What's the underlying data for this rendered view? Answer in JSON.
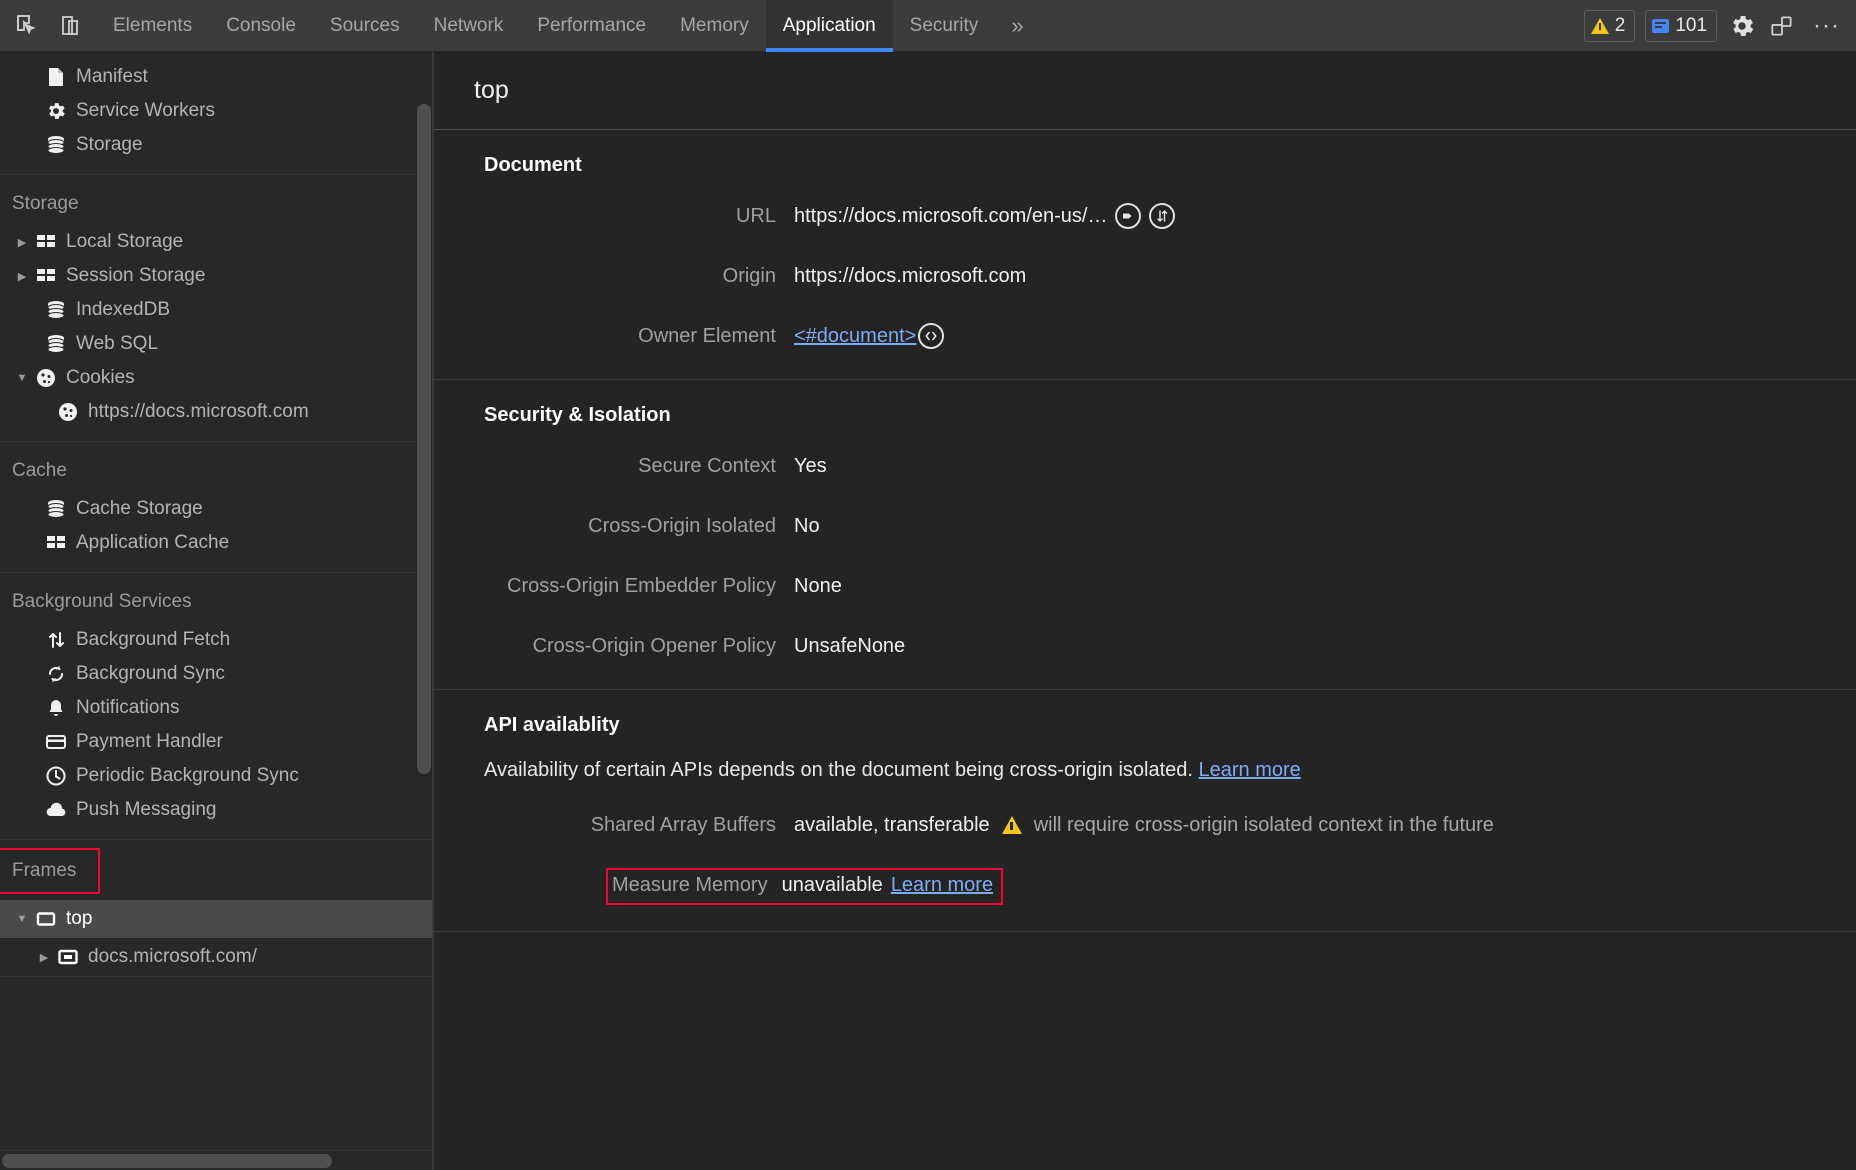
{
  "toolbar": {
    "icons": [
      {
        "name": "inspect-element-icon",
        "title": "Inspect element"
      },
      {
        "name": "device-toolbar-icon",
        "title": "Toggle device toolbar"
      }
    ],
    "tabs": [
      {
        "label": "Elements",
        "active": false
      },
      {
        "label": "Console",
        "active": false
      },
      {
        "label": "Sources",
        "active": false
      },
      {
        "label": "Network",
        "active": false
      },
      {
        "label": "Performance",
        "active": false
      },
      {
        "label": "Memory",
        "active": false
      },
      {
        "label": "Application",
        "active": true
      },
      {
        "label": "Security",
        "active": false
      }
    ],
    "more_tabs_glyph": "»",
    "warning_count": "2",
    "message_count": "101",
    "settings_label": "Settings",
    "dock_label": "Dock side",
    "more_options_glyph": "···"
  },
  "sidebar": {
    "groups": [
      {
        "title": null,
        "items": [
          {
            "label": "Manifest",
            "icon": "document-icon",
            "caret": null,
            "indent": 2,
            "selected": false
          },
          {
            "label": "Service Workers",
            "icon": "gear-icon",
            "caret": null,
            "indent": 2,
            "selected": false
          },
          {
            "label": "Storage",
            "icon": "database-icon",
            "caret": null,
            "indent": 2,
            "selected": false
          }
        ]
      },
      {
        "title": "Storage",
        "items": [
          {
            "label": "Local Storage",
            "icon": "table-icon",
            "caret": "collapsed",
            "indent": 1,
            "selected": false
          },
          {
            "label": "Session Storage",
            "icon": "table-icon",
            "caret": "collapsed",
            "indent": 1,
            "selected": false
          },
          {
            "label": "IndexedDB",
            "icon": "database-icon",
            "caret": null,
            "indent": 2,
            "selected": false
          },
          {
            "label": "Web SQL",
            "icon": "database-icon",
            "caret": null,
            "indent": 2,
            "selected": false
          },
          {
            "label": "Cookies",
            "icon": "cookie-icon",
            "caret": "expanded",
            "indent": 1,
            "selected": false
          },
          {
            "label": "https://docs.microsoft.com",
            "icon": "cookie-icon",
            "caret": null,
            "indent": 3,
            "selected": false
          }
        ]
      },
      {
        "title": "Cache",
        "items": [
          {
            "label": "Cache Storage",
            "icon": "database-icon",
            "caret": null,
            "indent": 2,
            "selected": false
          },
          {
            "label": "Application Cache",
            "icon": "table-icon",
            "caret": null,
            "indent": 2,
            "selected": false
          }
        ]
      },
      {
        "title": "Background Services",
        "items": [
          {
            "label": "Background Fetch",
            "icon": "updown-arrows-icon",
            "caret": null,
            "indent": 2,
            "selected": false
          },
          {
            "label": "Background Sync",
            "icon": "sync-icon",
            "caret": null,
            "indent": 2,
            "selected": false
          },
          {
            "label": "Notifications",
            "icon": "bell-icon",
            "caret": null,
            "indent": 2,
            "selected": false
          },
          {
            "label": "Payment Handler",
            "icon": "credit-card-icon",
            "caret": null,
            "indent": 2,
            "selected": false
          },
          {
            "label": "Periodic Background Sync",
            "icon": "clock-icon",
            "caret": null,
            "indent": 2,
            "selected": false
          },
          {
            "label": "Push Messaging",
            "icon": "cloud-icon",
            "caret": null,
            "indent": 2,
            "selected": false
          }
        ]
      },
      {
        "title": "Frames",
        "title_highlighted": true,
        "items": [
          {
            "label": "top",
            "icon": "frame-icon",
            "caret": "expanded",
            "indent": 1,
            "selected": true
          },
          {
            "label": "docs.microsoft.com/",
            "icon": "subframe-icon",
            "caret": "collapsed",
            "indent": 3,
            "selected": false
          }
        ]
      }
    ]
  },
  "main": {
    "header_title": "top",
    "sections": [
      {
        "title": "Document",
        "rows": [
          {
            "key": "URL",
            "value": "https://docs.microsoft.com/en-us/…",
            "icons": [
              "open-in-sources-icon",
              "open-in-network-icon"
            ]
          },
          {
            "key": "Origin",
            "value": "https://docs.microsoft.com",
            "icons": []
          },
          {
            "key": "Owner Element",
            "value": "<#document>",
            "link": true,
            "icons": [
              "reveal-in-elements-icon"
            ]
          }
        ]
      },
      {
        "title": "Security & Isolation",
        "rows": [
          {
            "key": "Secure Context",
            "value": "Yes",
            "icons": []
          },
          {
            "key": "Cross-Origin Isolated",
            "value": "No",
            "icons": []
          },
          {
            "key": "Cross-Origin Embedder Policy",
            "value": "None",
            "icons": []
          },
          {
            "key": "Cross-Origin Opener Policy",
            "value": "UnsafeNone",
            "icons": []
          }
        ]
      },
      {
        "title": "API availablity",
        "description": "Availability of certain APIs depends on the document being cross-origin isolated.",
        "description_link": "Learn more",
        "rows": [
          {
            "key": "Shared Array Buffers",
            "value": "available, transferable",
            "warning": true,
            "warning_text": "will require cross-origin isolated context in the future"
          },
          {
            "key": "Measure Memory",
            "value": "unavailable",
            "link_text": "Learn more",
            "highlighted": true
          }
        ]
      }
    ]
  },
  "colors": {
    "accent": "#4285f4",
    "annotation": "#ff0033",
    "warning": "#f5c518",
    "link": "#7cacf8"
  }
}
